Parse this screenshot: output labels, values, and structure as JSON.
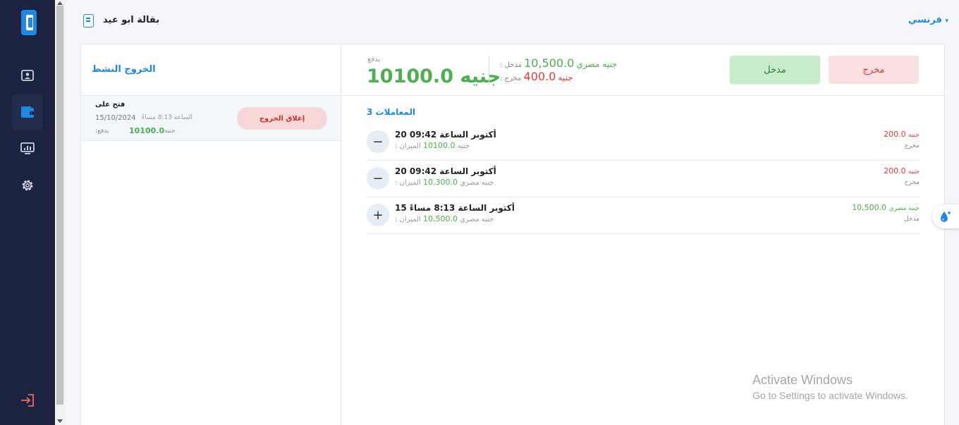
{
  "app": {
    "shop_name": "بقالة ابو عيد",
    "language": "فرنسي"
  },
  "sidebar": {
    "items": [
      {
        "icon": "contacts-icon"
      },
      {
        "icon": "wallet-icon",
        "active": true
      },
      {
        "icon": "monitor-chart-icon"
      },
      {
        "icon": "settings-icon"
      }
    ],
    "logout_icon": "logout-icon"
  },
  "left_panel": {
    "title": "الخروج النشط",
    "shift": {
      "opened_on": "فتح على",
      "date": "15/10/2024",
      "time": "الساعة 8:13 مساءً",
      "paid_label": "يدفع:",
      "amount": "10100.0",
      "currency": "جنيه",
      "close_button": "إغلاق الخروج"
    }
  },
  "summary": {
    "pay_label": "يدفع",
    "pay_amount": "جنيه 10100.0",
    "in_label": "مدخل :",
    "in_amount": "10,500.0",
    "in_currency": "جنيه مصري",
    "out_label": "مخرج :",
    "out_amount": "400.0",
    "out_currency": "جنيه",
    "btn_in": "مدخل",
    "btn_out": "مخرج"
  },
  "transactions": {
    "count_label": "المعاملات 3",
    "items": [
      {
        "title": "أكتوبر الساعة 09:42 20",
        "balance_label": "الميزان :",
        "balance": "10100.0",
        "balance_currency": "جنيه",
        "amount": "200.0",
        "currency": "جنيه",
        "type": "مخرج",
        "sign": "−",
        "direction": "out"
      },
      {
        "title": "أكتوبر الساعة 09:42 20",
        "balance_label": "الميزان :",
        "balance": "10,300.0",
        "balance_currency": "جنيه مصري",
        "amount": "200.0",
        "currency": "جنيه",
        "type": "مخرج",
        "sign": "−",
        "direction": "out"
      },
      {
        "title": "أكتوبر الساعة 8:13 مساءً 15",
        "balance_label": "الميزان :",
        "balance": "10,500.0",
        "balance_currency": "جنيه مصري",
        "amount": "10,500.0",
        "currency": "جنيه مصري",
        "type": "مدخل",
        "sign": "+",
        "direction": "in"
      }
    ]
  },
  "watermark": {
    "title": "Activate Windows",
    "subtitle": "Go to Settings to activate Windows."
  },
  "colors": {
    "sidebar": "#1b2340",
    "accent": "#1e88e5",
    "positive": "#4caf50",
    "negative": "#e53935"
  }
}
